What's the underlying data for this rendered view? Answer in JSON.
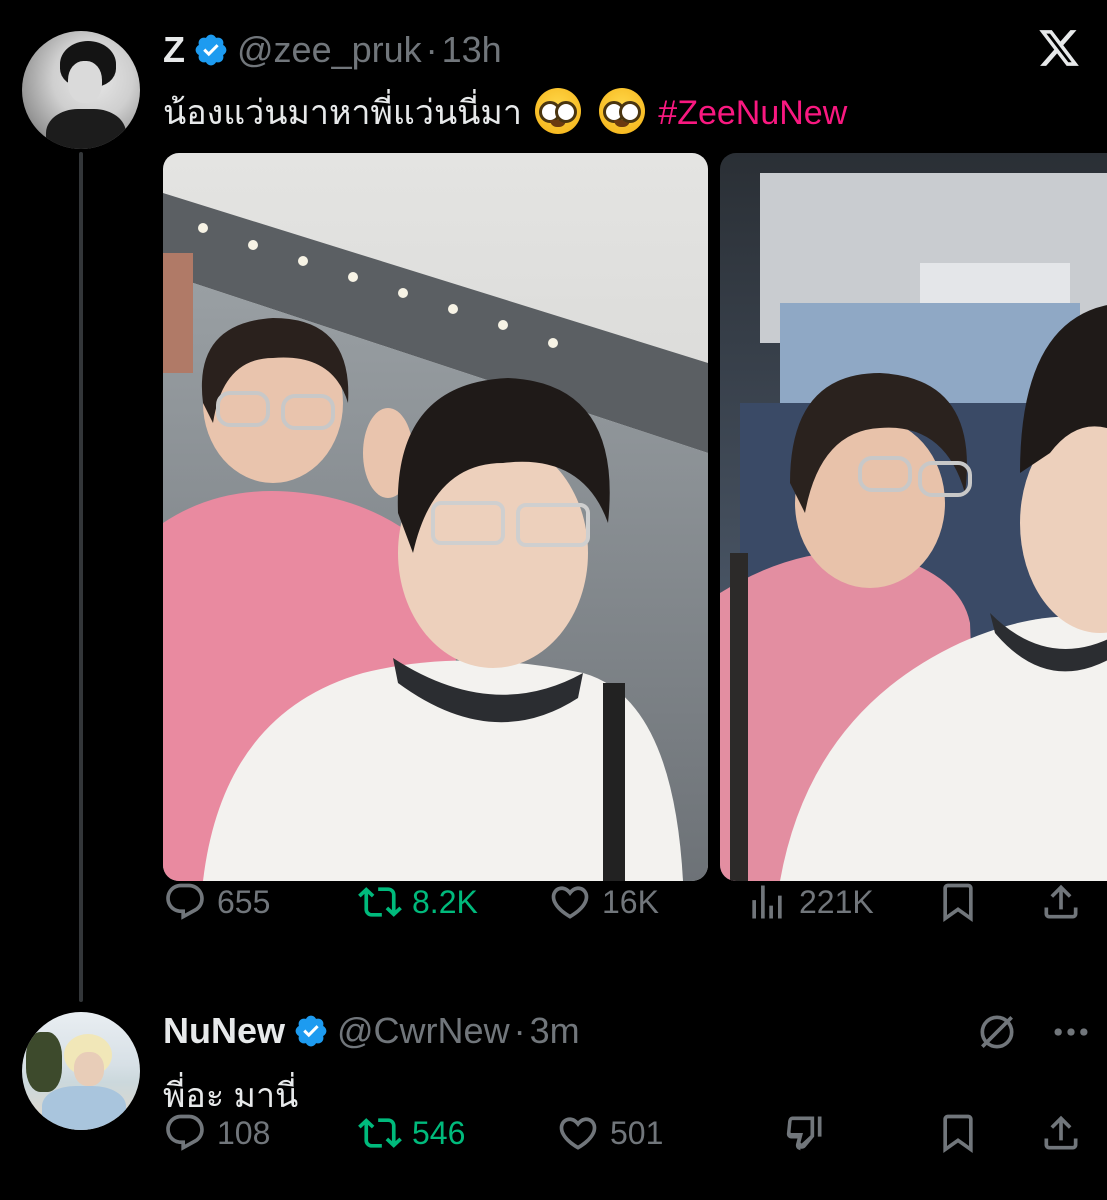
{
  "colors": {
    "background": "#000000",
    "text": "#e7e9ea",
    "muted": "#71767b",
    "verified": "#1d9bf0",
    "hashtag": "#f91880",
    "retweet_active": "#00ba7c"
  },
  "app": {
    "logo": "x-logo-icon"
  },
  "tweet": {
    "display_name": "Z",
    "handle": "@zee_pruk",
    "dot": "·",
    "time": "13h",
    "text": "น้องแว่นมาหาพี่แว่นนี่มา",
    "emojis": [
      "nerd-face-emoji",
      "nerd-face-emoji"
    ],
    "hashtag": "#ZeeNuNew",
    "media": [
      {
        "type": "photo",
        "icon": "selfie-photo-1"
      },
      {
        "type": "photo",
        "icon": "selfie-photo-2"
      }
    ],
    "actions": {
      "replies": "655",
      "retweets": "8.2K",
      "likes": "16K",
      "views": "221K"
    }
  },
  "reply": {
    "display_name": "NuNew",
    "handle": "@CwrNew",
    "dot": "·",
    "time": "3m",
    "text": "พี่อะ มานี่",
    "actions": {
      "replies": "108",
      "retweets": "546",
      "likes": "501"
    }
  }
}
